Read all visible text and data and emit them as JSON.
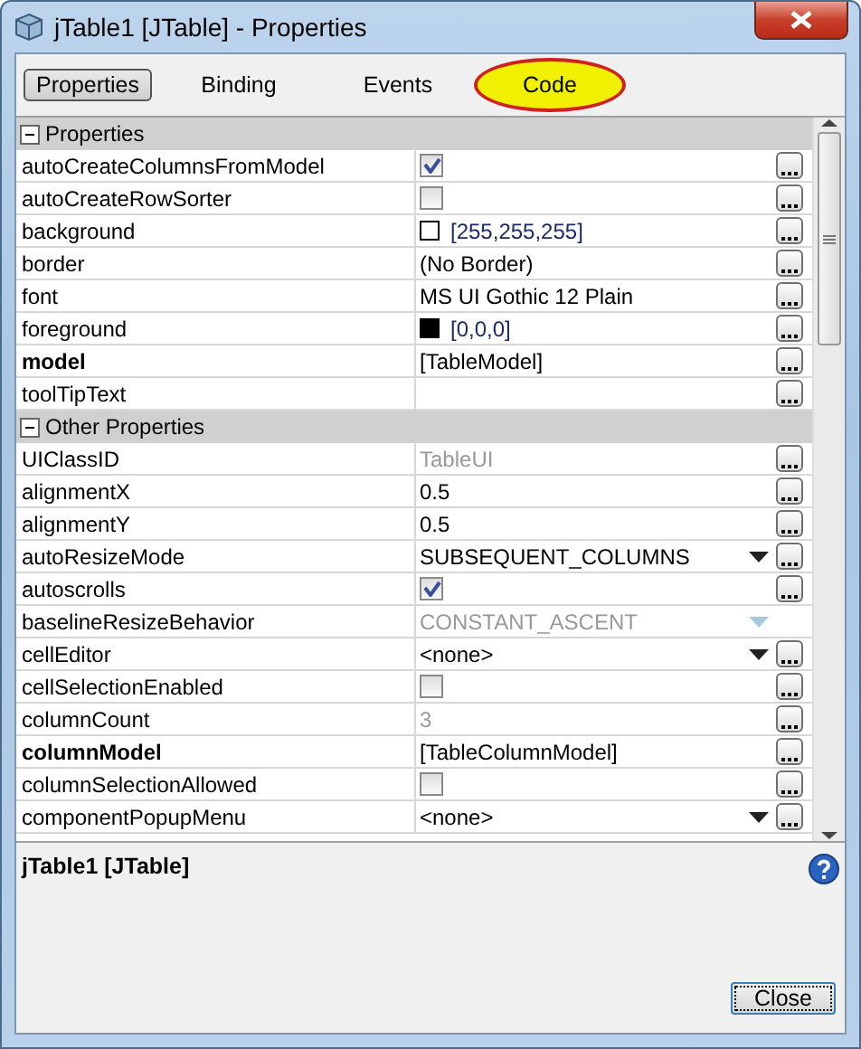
{
  "window": {
    "title": "jTable1 [JTable] - Properties"
  },
  "tabs": [
    {
      "label": "Properties",
      "selected": true,
      "highlighted": false
    },
    {
      "label": "Binding",
      "selected": false,
      "highlighted": false
    },
    {
      "label": "Events",
      "selected": false,
      "highlighted": false
    },
    {
      "label": "Code",
      "selected": false,
      "highlighted": true
    }
  ],
  "rows": [
    {
      "kind": "section",
      "name": "Properties",
      "expanded": true
    },
    {
      "kind": "checkbox",
      "name": "autoCreateColumnsFromModel",
      "checked": true
    },
    {
      "kind": "checkbox",
      "name": "autoCreateRowSorter",
      "checked": false
    },
    {
      "kind": "color",
      "name": "background",
      "value": "[255,255,255]",
      "color": "#ffffff"
    },
    {
      "kind": "text",
      "name": "border",
      "value": "(No Border)"
    },
    {
      "kind": "text",
      "name": "font",
      "value": "MS UI Gothic 12 Plain"
    },
    {
      "kind": "color",
      "name": "foreground",
      "value": "[0,0,0]",
      "color": "#000000"
    },
    {
      "kind": "text",
      "name": "model",
      "value": "[TableModel]",
      "bold": true
    },
    {
      "kind": "text",
      "name": "toolTipText"
    },
    {
      "kind": "section",
      "name": "Other Properties",
      "expanded": true
    },
    {
      "kind": "text",
      "name": "UIClassID",
      "value": "TableUI",
      "disabled": true
    },
    {
      "kind": "text",
      "name": "alignmentX",
      "value": "0.5"
    },
    {
      "kind": "text",
      "name": "alignmentY",
      "value": "0.5"
    },
    {
      "kind": "combo",
      "name": "autoResizeMode",
      "value": "SUBSEQUENT_COLUMNS"
    },
    {
      "kind": "checkbox",
      "name": "autoscrolls",
      "checked": true
    },
    {
      "kind": "combo",
      "name": "baselineResizeBehavior",
      "value": "CONSTANT_ASCENT",
      "disabled": true
    },
    {
      "kind": "combo",
      "name": "cellEditor",
      "value": "<none>"
    },
    {
      "kind": "checkbox",
      "name": "cellSelectionEnabled",
      "checked": false
    },
    {
      "kind": "text",
      "name": "columnCount",
      "value": "3",
      "disabled": true
    },
    {
      "kind": "text",
      "name": "columnModel",
      "value": "[TableColumnModel]",
      "bold": true
    },
    {
      "kind": "checkbox",
      "name": "columnSelectionAllowed",
      "checked": false
    },
    {
      "kind": "combo",
      "name": "componentPopupMenu",
      "value": "<none>"
    }
  ],
  "description": {
    "title": "jTable1 [JTable]"
  },
  "buttons": [
    "Close"
  ]
}
